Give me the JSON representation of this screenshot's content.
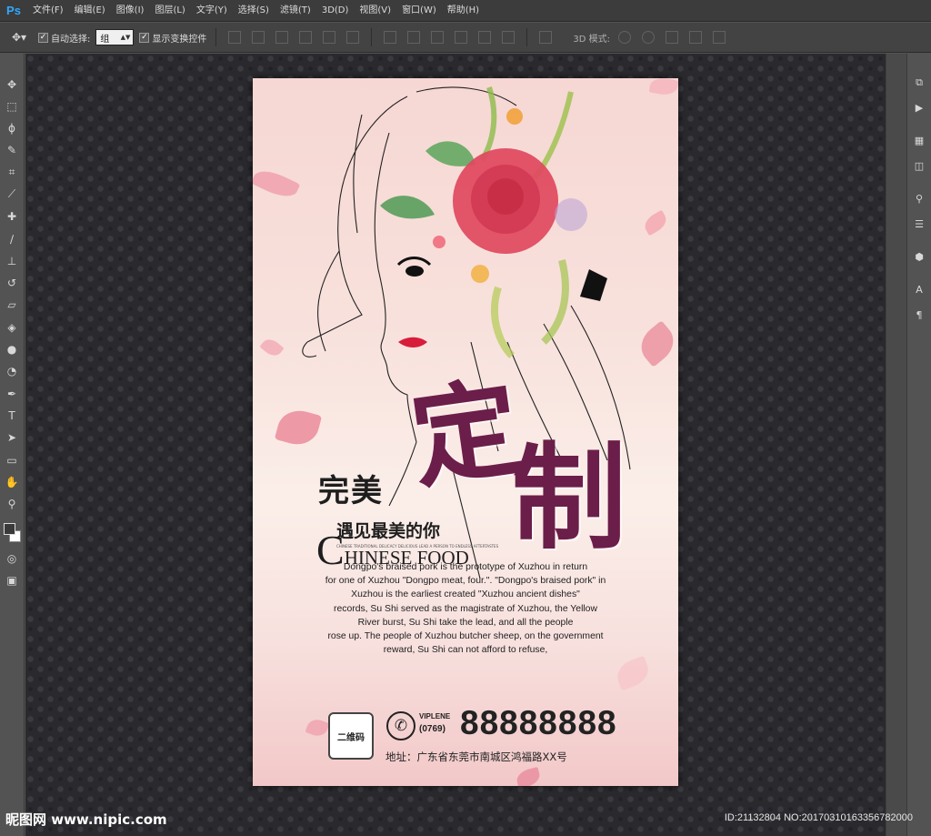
{
  "app": {
    "logo": "Ps"
  },
  "menu": [
    "文件(F)",
    "编辑(E)",
    "图像(I)",
    "图层(L)",
    "文字(Y)",
    "选择(S)",
    "滤镜(T)",
    "3D(D)",
    "视图(V)",
    "窗口(W)",
    "帮助(H)"
  ],
  "options": {
    "auto_select_label": "自动选择:",
    "auto_select_value": "组",
    "show_transform_label": "显示变换控件",
    "mode_3d_label": "3D 模式:"
  },
  "poster": {
    "title_small": "完美",
    "title_big_1": "定",
    "title_big_2": "制",
    "subtitle_cn": "遇见最美的你",
    "tiny_line": "CHINESE TRADITIONAL DELICACY DELICIOUS LEAD A PERSON TO ENDLESS AFTERTASTES",
    "cf_big_c": "C",
    "cf_rest": "HINESE FOOD",
    "body_lines": [
      "Dongpo's braised pork is the prototype of Xuzhou in return",
      "for one of Xuzhou \"Dongpo meat, four.\". \"Dongpo's braised pork\" in",
      "Xuzhou is the earliest created \"Xuzhou ancient dishes\"",
      "records, Su Shi served as the magistrate of Xuzhou, the Yellow",
      "River burst, Su Shi take the lead, and all the people",
      "rose up. The people of Xuzhou butcher sheep, on the government",
      "reward, Su Shi can not afford to refuse,"
    ],
    "qr_label": "二维码",
    "viplene": "VIPLENE",
    "area_code": "(0769)",
    "phone": "88888888",
    "address": "地址：广东省东莞市南城区鸿福路XX号"
  },
  "watermark": {
    "left": "昵图网 www.nipic.com",
    "right": "ID:21132804 NO:20170310163356782000"
  },
  "colors": {
    "accent_title": "#6b1e4a",
    "ps_blue": "#31a8ff",
    "flower_red": "#e0485e"
  }
}
